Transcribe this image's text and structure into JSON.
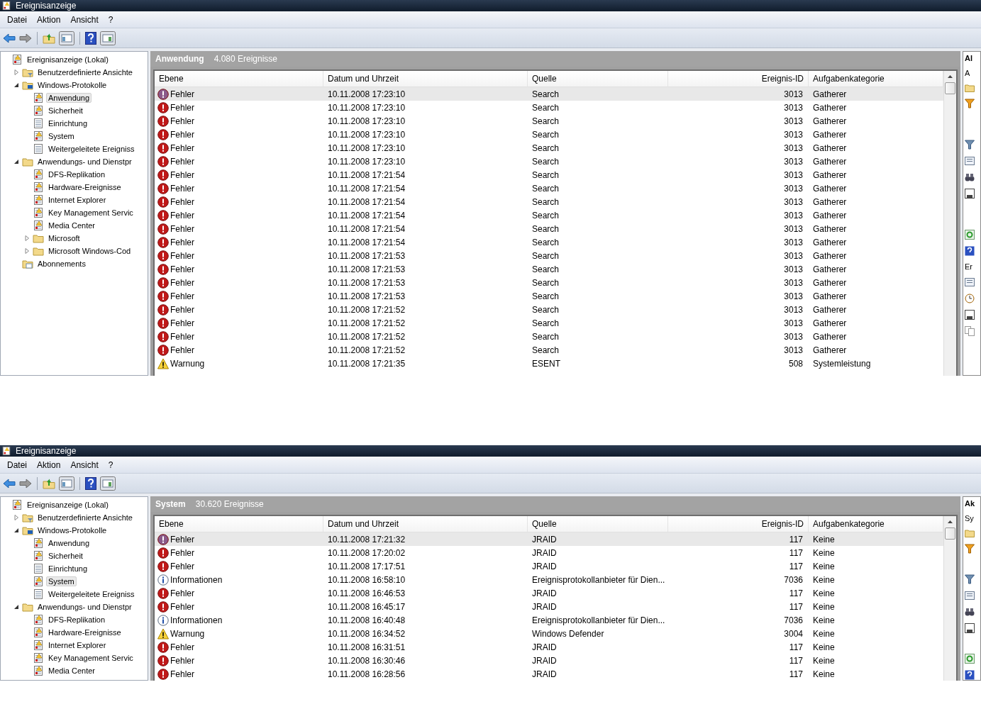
{
  "windows": [
    {
      "title": "Ereignisanzeige",
      "menu": [
        "Datei",
        "Aktion",
        "Ansicht",
        "?"
      ],
      "tree": [
        {
          "label": "Ereignisanzeige (Lokal)",
          "kind": "root",
          "selected": false,
          "children": [
            {
              "label": "Benutzerdefinierte Ansichte",
              "kind": "filter-folder",
              "selected": false,
              "expanded": false
            },
            {
              "label": "Windows-Protokolle",
              "kind": "computer-folder",
              "selected": false,
              "expanded": true,
              "children": [
                {
                  "label": "Anwendung",
                  "kind": "log",
                  "selected": true
                },
                {
                  "label": "Sicherheit",
                  "kind": "log",
                  "selected": false
                },
                {
                  "label": "Einrichtung",
                  "kind": "plain-log",
                  "selected": false
                },
                {
                  "label": "System",
                  "kind": "log",
                  "selected": false
                },
                {
                  "label": "Weitergeleitete Ereigniss",
                  "kind": "plain-log",
                  "selected": false
                }
              ]
            },
            {
              "label": "Anwendungs- und Dienstpr",
              "kind": "folder",
              "selected": false,
              "expanded": true,
              "children": [
                {
                  "label": "DFS-Replikation",
                  "kind": "log",
                  "selected": false
                },
                {
                  "label": "Hardware-Ereignisse",
                  "kind": "log",
                  "selected": false
                },
                {
                  "label": "Internet Explorer",
                  "kind": "log",
                  "selected": false
                },
                {
                  "label": "Key Management Servic",
                  "kind": "log",
                  "selected": false
                },
                {
                  "label": "Media Center",
                  "kind": "log",
                  "selected": false
                },
                {
                  "label": "Microsoft",
                  "kind": "folder",
                  "selected": false,
                  "expanded": false
                },
                {
                  "label": "Microsoft Windows-Cod",
                  "kind": "folder",
                  "selected": false,
                  "expanded": false
                }
              ]
            },
            {
              "label": "Abonnements",
              "kind": "subscription",
              "selected": false
            }
          ]
        }
      ],
      "pane": {
        "title": "Anwendung",
        "count": "4.080 Ereignisse"
      },
      "columns": [
        "Ebene",
        "Datum und Uhrzeit",
        "Quelle",
        "Ereignis-ID",
        "Aufgabenkategorie"
      ],
      "rows": [
        {
          "kind": "error",
          "ebene": "Fehler",
          "datum": "10.11.2008 17:23:10",
          "quelle": "Search",
          "id": "3013",
          "kategorie": "Gatherer",
          "selected": true
        },
        {
          "kind": "error",
          "ebene": "Fehler",
          "datum": "10.11.2008 17:23:10",
          "quelle": "Search",
          "id": "3013",
          "kategorie": "Gatherer",
          "selected": false
        },
        {
          "kind": "error",
          "ebene": "Fehler",
          "datum": "10.11.2008 17:23:10",
          "quelle": "Search",
          "id": "3013",
          "kategorie": "Gatherer",
          "selected": false
        },
        {
          "kind": "error",
          "ebene": "Fehler",
          "datum": "10.11.2008 17:23:10",
          "quelle": "Search",
          "id": "3013",
          "kategorie": "Gatherer",
          "selected": false
        },
        {
          "kind": "error",
          "ebene": "Fehler",
          "datum": "10.11.2008 17:23:10",
          "quelle": "Search",
          "id": "3013",
          "kategorie": "Gatherer",
          "selected": false
        },
        {
          "kind": "error",
          "ebene": "Fehler",
          "datum": "10.11.2008 17:23:10",
          "quelle": "Search",
          "id": "3013",
          "kategorie": "Gatherer",
          "selected": false
        },
        {
          "kind": "error",
          "ebene": "Fehler",
          "datum": "10.11.2008 17:21:54",
          "quelle": "Search",
          "id": "3013",
          "kategorie": "Gatherer",
          "selected": false
        },
        {
          "kind": "error",
          "ebene": "Fehler",
          "datum": "10.11.2008 17:21:54",
          "quelle": "Search",
          "id": "3013",
          "kategorie": "Gatherer",
          "selected": false
        },
        {
          "kind": "error",
          "ebene": "Fehler",
          "datum": "10.11.2008 17:21:54",
          "quelle": "Search",
          "id": "3013",
          "kategorie": "Gatherer",
          "selected": false
        },
        {
          "kind": "error",
          "ebene": "Fehler",
          "datum": "10.11.2008 17:21:54",
          "quelle": "Search",
          "id": "3013",
          "kategorie": "Gatherer",
          "selected": false
        },
        {
          "kind": "error",
          "ebene": "Fehler",
          "datum": "10.11.2008 17:21:54",
          "quelle": "Search",
          "id": "3013",
          "kategorie": "Gatherer",
          "selected": false
        },
        {
          "kind": "error",
          "ebene": "Fehler",
          "datum": "10.11.2008 17:21:54",
          "quelle": "Search",
          "id": "3013",
          "kategorie": "Gatherer",
          "selected": false
        },
        {
          "kind": "error",
          "ebene": "Fehler",
          "datum": "10.11.2008 17:21:53",
          "quelle": "Search",
          "id": "3013",
          "kategorie": "Gatherer",
          "selected": false
        },
        {
          "kind": "error",
          "ebene": "Fehler",
          "datum": "10.11.2008 17:21:53",
          "quelle": "Search",
          "id": "3013",
          "kategorie": "Gatherer",
          "selected": false
        },
        {
          "kind": "error",
          "ebene": "Fehler",
          "datum": "10.11.2008 17:21:53",
          "quelle": "Search",
          "id": "3013",
          "kategorie": "Gatherer",
          "selected": false
        },
        {
          "kind": "error",
          "ebene": "Fehler",
          "datum": "10.11.2008 17:21:53",
          "quelle": "Search",
          "id": "3013",
          "kategorie": "Gatherer",
          "selected": false
        },
        {
          "kind": "error",
          "ebene": "Fehler",
          "datum": "10.11.2008 17:21:52",
          "quelle": "Search",
          "id": "3013",
          "kategorie": "Gatherer",
          "selected": false
        },
        {
          "kind": "error",
          "ebene": "Fehler",
          "datum": "10.11.2008 17:21:52",
          "quelle": "Search",
          "id": "3013",
          "kategorie": "Gatherer",
          "selected": false
        },
        {
          "kind": "error",
          "ebene": "Fehler",
          "datum": "10.11.2008 17:21:52",
          "quelle": "Search",
          "id": "3013",
          "kategorie": "Gatherer",
          "selected": false
        },
        {
          "kind": "error",
          "ebene": "Fehler",
          "datum": "10.11.2008 17:21:52",
          "quelle": "Search",
          "id": "3013",
          "kategorie": "Gatherer",
          "selected": false
        },
        {
          "kind": "warning",
          "ebene": "Warnung",
          "datum": "10.11.2008 17:21:35",
          "quelle": "ESENT",
          "id": "508",
          "kategorie": "Systemleistung",
          "selected": false
        }
      ],
      "actions": {
        "header": "Al",
        "items": [
          "A"
        ],
        "section": "Er"
      }
    },
    {
      "title": "Ereignisanzeige",
      "menu": [
        "Datei",
        "Aktion",
        "Ansicht",
        "?"
      ],
      "tree": [
        {
          "label": "Ereignisanzeige (Lokal)",
          "kind": "root",
          "selected": false,
          "children": [
            {
              "label": "Benutzerdefinierte Ansichte",
              "kind": "filter-folder",
              "selected": false,
              "expanded": false
            },
            {
              "label": "Windows-Protokolle",
              "kind": "computer-folder",
              "selected": false,
              "expanded": true,
              "children": [
                {
                  "label": "Anwendung",
                  "kind": "log",
                  "selected": false
                },
                {
                  "label": "Sicherheit",
                  "kind": "log",
                  "selected": false
                },
                {
                  "label": "Einrichtung",
                  "kind": "plain-log",
                  "selected": false
                },
                {
                  "label": "System",
                  "kind": "log",
                  "selected": true
                },
                {
                  "label": "Weitergeleitete Ereigniss",
                  "kind": "plain-log",
                  "selected": false
                }
              ]
            },
            {
              "label": "Anwendungs- und Dienstpr",
              "kind": "folder",
              "selected": false,
              "expanded": true,
              "children": [
                {
                  "label": "DFS-Replikation",
                  "kind": "log",
                  "selected": false
                },
                {
                  "label": "Hardware-Ereignisse",
                  "kind": "log",
                  "selected": false
                },
                {
                  "label": "Internet Explorer",
                  "kind": "log",
                  "selected": false
                },
                {
                  "label": "Key Management Servic",
                  "kind": "log",
                  "selected": false
                },
                {
                  "label": "Media Center",
                  "kind": "log",
                  "selected": false
                }
              ]
            }
          ]
        }
      ],
      "pane": {
        "title": "System",
        "count": "30.620 Ereignisse"
      },
      "columns": [
        "Ebene",
        "Datum und Uhrzeit",
        "Quelle",
        "Ereignis-ID",
        "Aufgabenkategorie"
      ],
      "rows": [
        {
          "kind": "error",
          "ebene": "Fehler",
          "datum": "10.11.2008 17:21:32",
          "quelle": "JRAID",
          "id": "117",
          "kategorie": "Keine",
          "selected": true
        },
        {
          "kind": "error",
          "ebene": "Fehler",
          "datum": "10.11.2008 17:20:02",
          "quelle": "JRAID",
          "id": "117",
          "kategorie": "Keine",
          "selected": false
        },
        {
          "kind": "error",
          "ebene": "Fehler",
          "datum": "10.11.2008 17:17:51",
          "quelle": "JRAID",
          "id": "117",
          "kategorie": "Keine",
          "selected": false
        },
        {
          "kind": "info",
          "ebene": "Informationen",
          "datum": "10.11.2008 16:58:10",
          "quelle": "Ereignisprotokollanbieter für Dien...",
          "id": "7036",
          "kategorie": "Keine",
          "selected": false
        },
        {
          "kind": "error",
          "ebene": "Fehler",
          "datum": "10.11.2008 16:46:53",
          "quelle": "JRAID",
          "id": "117",
          "kategorie": "Keine",
          "selected": false
        },
        {
          "kind": "error",
          "ebene": "Fehler",
          "datum": "10.11.2008 16:45:17",
          "quelle": "JRAID",
          "id": "117",
          "kategorie": "Keine",
          "selected": false
        },
        {
          "kind": "info",
          "ebene": "Informationen",
          "datum": "10.11.2008 16:40:48",
          "quelle": "Ereignisprotokollanbieter für Dien...",
          "id": "7036",
          "kategorie": "Keine",
          "selected": false
        },
        {
          "kind": "warning",
          "ebene": "Warnung",
          "datum": "10.11.2008 16:34:52",
          "quelle": "Windows Defender",
          "id": "3004",
          "kategorie": "Keine",
          "selected": false
        },
        {
          "kind": "error",
          "ebene": "Fehler",
          "datum": "10.11.2008 16:31:51",
          "quelle": "JRAID",
          "id": "117",
          "kategorie": "Keine",
          "selected": false
        },
        {
          "kind": "error",
          "ebene": "Fehler",
          "datum": "10.11.2008 16:30:46",
          "quelle": "JRAID",
          "id": "117",
          "kategorie": "Keine",
          "selected": false
        },
        {
          "kind": "error",
          "ebene": "Fehler",
          "datum": "10.11.2008 16:28:56",
          "quelle": "JRAID",
          "id": "117",
          "kategorie": "Keine",
          "selected": false
        }
      ],
      "actions": {
        "header": "Ak",
        "items": [
          "Sy"
        ]
      }
    }
  ]
}
